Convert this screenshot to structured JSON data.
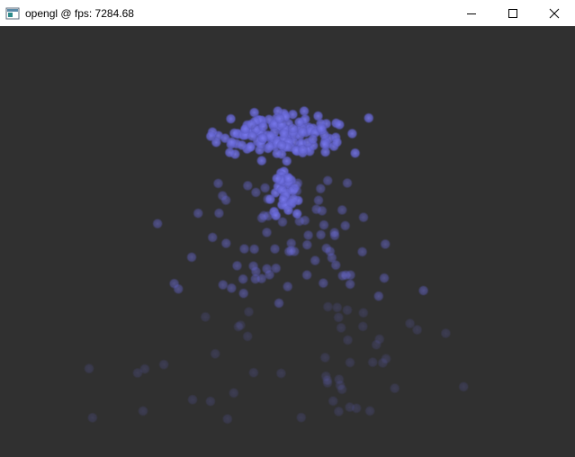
{
  "window": {
    "title": "opengl @ fps: 7284.68",
    "icon": "app-window-icon",
    "controls": [
      "minimize-icon",
      "maximize-icon",
      "close-icon"
    ]
  },
  "viewport": {
    "background": "#303030",
    "particle_color": "#6b6bd6",
    "particle_count": 300
  }
}
